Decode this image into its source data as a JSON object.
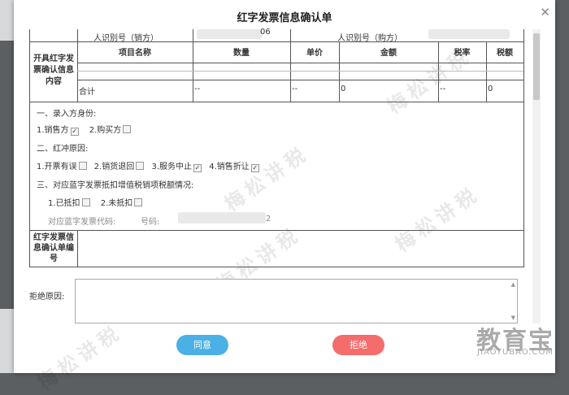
{
  "modal": {
    "title": "红字发票信息确认单"
  },
  "seller_row": {
    "label": "人识别号（销方）",
    "value_tail": "06",
    "buyer_label": "人识别号（购方）"
  },
  "section_confirm": {
    "label": "开具红字发票确认信息内容"
  },
  "table": {
    "headers": [
      "项目名称",
      "数量",
      "单价",
      "金额",
      "税率",
      "税额"
    ],
    "total_row": [
      "合计",
      "--",
      "--",
      "0",
      "--",
      "0"
    ]
  },
  "entry": {
    "heading": "一、录入方身份:",
    "seller": "1.销售方",
    "buyer": "2.购买方"
  },
  "reason": {
    "heading": "二、红冲原因:",
    "items": [
      "1.开票有误",
      "2.销货退回",
      "3.服务中止",
      "4.销售折让"
    ]
  },
  "deduction": {
    "heading": "三、对应蓝字发票抵扣增值税销项税额情况:",
    "yes": "1.已抵扣",
    "no": "2.未抵扣",
    "code_label": "对应蓝字发票代码:",
    "number_label": "号码:",
    "number_tail": "2"
  },
  "confirm_no": {
    "label": "红字发票信息确认单编号"
  },
  "reject_reason": {
    "label": "拒绝原因:",
    "value": ""
  },
  "buttons": {
    "agree": "同意",
    "reject": "拒绝"
  },
  "watermark": {
    "text": "梅松讲税"
  },
  "brand": {
    "name": "教育宝",
    "url": "JIAOYUBAO.COM"
  },
  "checkbox_state": {
    "seller": true,
    "buyer": false,
    "reason_error": false,
    "reason_return": false,
    "reason_stop": true,
    "reason_discount": true,
    "deducted": false,
    "not_deducted": false
  }
}
